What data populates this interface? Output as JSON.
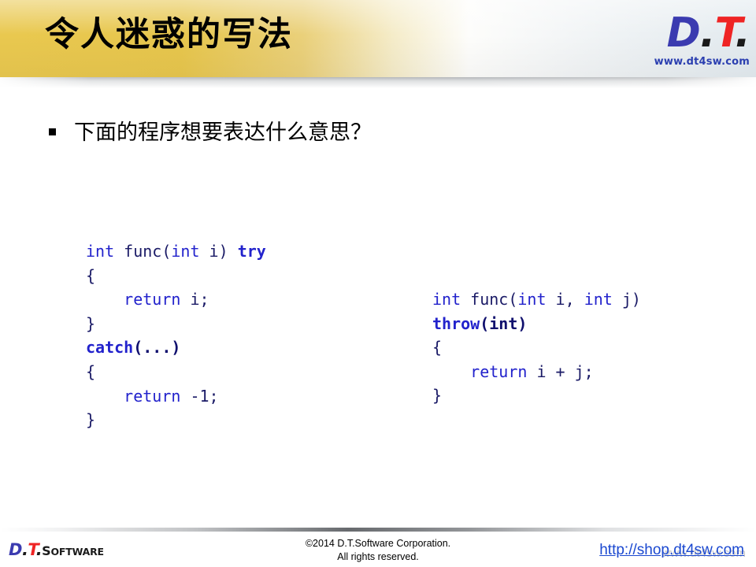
{
  "slide": {
    "title": "令人迷惑的写法",
    "background_color": "#ffffff",
    "header": {
      "gradient_from": "#e9c84f",
      "gradient_to": "#e2eaef",
      "logo": {
        "d": "D",
        "dot1": ".",
        "t": "T",
        "dot2": ".",
        "website": "www.dt4sw.com"
      }
    },
    "body": {
      "bullet": {
        "marker": "square-bullet",
        "text": "下面的程序想要表达什么意思？"
      },
      "code_blocks": [
        {
          "name": "function-try-block-example",
          "lines": [
            [
              {
                "t": "int",
                "s": "kw"
              },
              {
                "t": " func",
                "s": "pl"
              },
              {
                "t": "(",
                "s": "pl"
              },
              {
                "t": "int",
                "s": "kw"
              },
              {
                "t": " i",
                "s": "pl"
              },
              {
                "t": ") ",
                "s": "pl"
              },
              {
                "t": "try",
                "s": "kw-b"
              }
            ],
            [
              {
                "t": "{",
                "s": "pl"
              }
            ],
            [
              {
                "t": "    ",
                "s": "pl"
              },
              {
                "t": "return",
                "s": "kw"
              },
              {
                "t": " i;",
                "s": "pl"
              }
            ],
            [
              {
                "t": "}",
                "s": "pl"
              }
            ],
            [
              {
                "t": "catch",
                "s": "kw-b"
              },
              {
                "t": "(...)",
                "s": "pl-b"
              }
            ],
            [
              {
                "t": "{",
                "s": "pl"
              }
            ],
            [
              {
                "t": "    ",
                "s": "pl"
              },
              {
                "t": "return",
                "s": "kw"
              },
              {
                "t": " -1;",
                "s": "pl"
              }
            ],
            [
              {
                "t": "}",
                "s": "pl"
              }
            ]
          ]
        },
        {
          "name": "exception-specification-example",
          "lines": [
            [
              {
                "t": "int",
                "s": "kw"
              },
              {
                "t": " func",
                "s": "pl"
              },
              {
                "t": "(",
                "s": "pl"
              },
              {
                "t": "int",
                "s": "kw"
              },
              {
                "t": " i, ",
                "s": "pl"
              },
              {
                "t": "int",
                "s": "kw"
              },
              {
                "t": " j)",
                "s": "pl"
              }
            ],
            [
              {
                "t": "throw",
                "s": "kw-b"
              },
              {
                "t": "(int)",
                "s": "pl-b"
              }
            ],
            [
              {
                "t": "{",
                "s": "pl"
              }
            ],
            [
              {
                "t": "    ",
                "s": "pl"
              },
              {
                "t": "return",
                "s": "kw"
              },
              {
                "t": " i + j;",
                "s": "pl"
              }
            ],
            [
              {
                "t": "}",
                "s": "pl"
              }
            ]
          ]
        }
      ]
    },
    "footer": {
      "logo": {
        "d": "D",
        "dot1": ".",
        "t": "T",
        "dot2": ".",
        "software_first": "S",
        "software_rest": "OFTWARE"
      },
      "copyright_line1": "©2014 D.T.Software Corporation.",
      "copyright_line2": "All rights reserved.",
      "link": "http://shop.dt4sw.com",
      "watermark": "www.dt4sw.com"
    }
  }
}
